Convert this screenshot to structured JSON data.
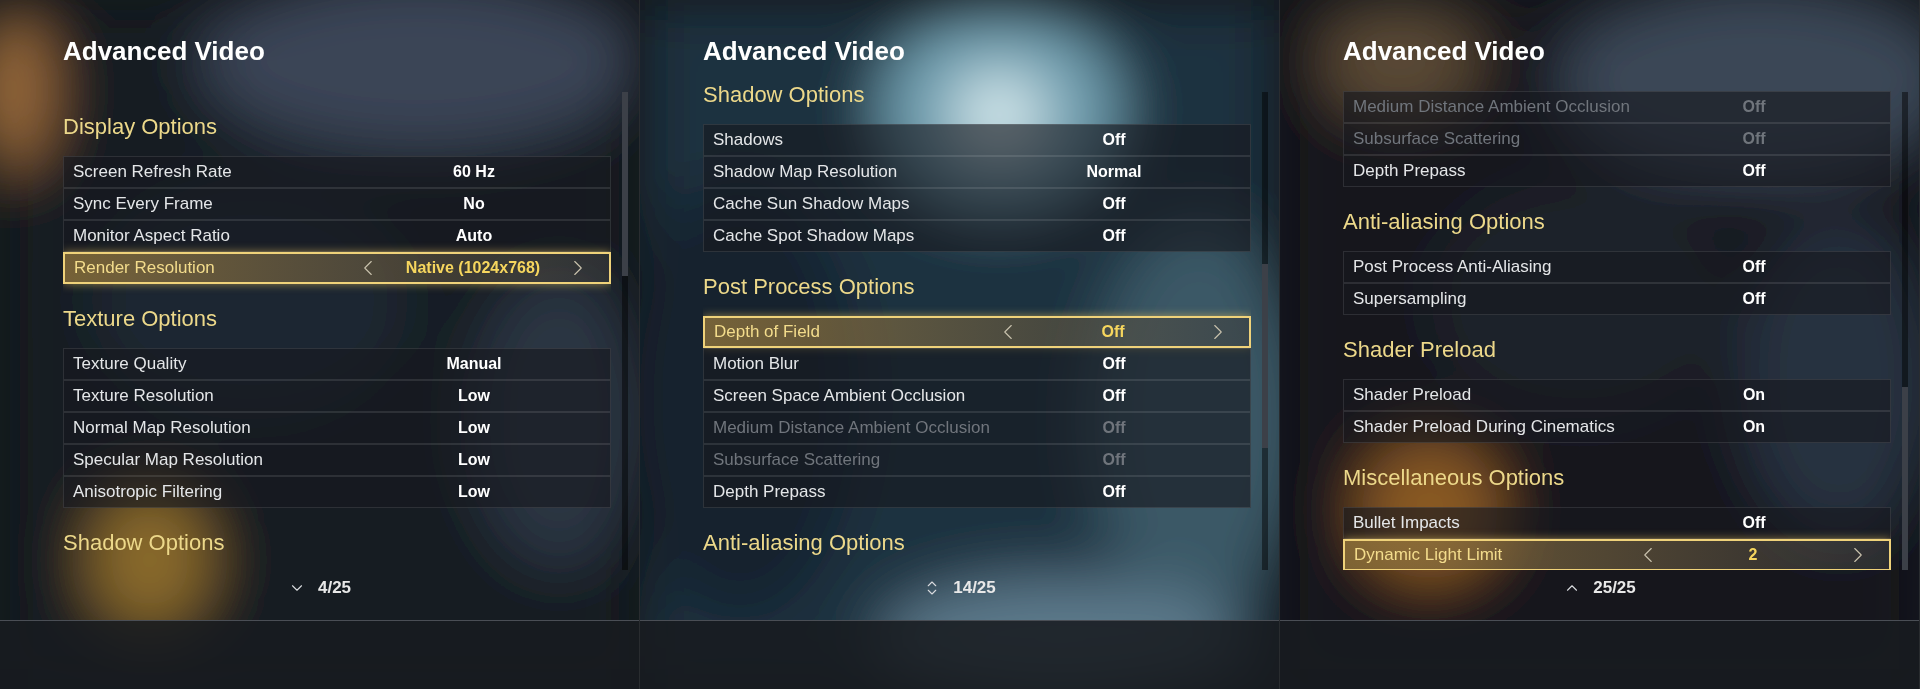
{
  "panels": [
    {
      "title": "Advanced Video",
      "can_scroll_up": false,
      "can_scroll_down": true,
      "counter": "4/25",
      "sections": [
        {
          "header": "Display Options",
          "rows": [
            {
              "label": "Screen Refresh Rate",
              "value": "60 Hz",
              "selected": false,
              "disabled": false
            },
            {
              "label": "Sync Every Frame",
              "value": "No",
              "selected": false,
              "disabled": false
            },
            {
              "label": "Monitor Aspect Ratio",
              "value": "Auto",
              "selected": false,
              "disabled": false
            },
            {
              "label": "Render Resolution",
              "value": "Native (1024x768)",
              "selected": true,
              "disabled": false
            }
          ]
        },
        {
          "header": "Texture Options",
          "rows": [
            {
              "label": "Texture Quality",
              "value": "Manual",
              "selected": false,
              "disabled": false
            },
            {
              "label": "Texture Resolution",
              "value": "Low",
              "selected": false,
              "disabled": false
            },
            {
              "label": "Normal Map Resolution",
              "value": "Low",
              "selected": false,
              "disabled": false
            },
            {
              "label": "Specular Map Resolution",
              "value": "Low",
              "selected": false,
              "disabled": false
            },
            {
              "label": "Anisotropic Filtering",
              "value": "Low",
              "selected": false,
              "disabled": false
            }
          ]
        },
        {
          "header": "Shadow Options"
        }
      ]
    },
    {
      "title": "Advanced Video",
      "can_scroll_up": true,
      "can_scroll_down": true,
      "counter": "14/25",
      "sections": [
        {
          "header": "Shadow Options",
          "rows": [
            {
              "label": "Shadows",
              "value": "Off",
              "selected": false,
              "disabled": false
            },
            {
              "label": "Shadow Map Resolution",
              "value": "Normal",
              "selected": false,
              "disabled": false
            },
            {
              "label": "Cache Sun Shadow Maps",
              "value": "Off",
              "selected": false,
              "disabled": false
            },
            {
              "label": "Cache Spot Shadow Maps",
              "value": "Off",
              "selected": false,
              "disabled": false
            }
          ]
        },
        {
          "header": "Post Process Options",
          "rows": [
            {
              "label": "Depth of Field",
              "value": "Off",
              "selected": true,
              "disabled": false
            },
            {
              "label": "Motion Blur",
              "value": "Off",
              "selected": false,
              "disabled": false
            },
            {
              "label": "Screen Space Ambient Occlusion",
              "value": "Off",
              "selected": false,
              "disabled": false
            },
            {
              "label": "Medium Distance Ambient Occlusion",
              "value": "Off",
              "selected": false,
              "disabled": true
            },
            {
              "label": "Subsurface Scattering",
              "value": "Off",
              "selected": false,
              "disabled": true
            },
            {
              "label": "Depth Prepass",
              "value": "Off",
              "selected": false,
              "disabled": false
            }
          ]
        },
        {
          "header": "Anti-aliasing Options"
        }
      ]
    },
    {
      "title": "Advanced Video",
      "can_scroll_up": true,
      "can_scroll_down": false,
      "counter": "25/25",
      "sections": [
        {
          "rows": [
            {
              "label": "Medium Distance Ambient Occlusion",
              "value": "Off",
              "selected": false,
              "disabled": true
            },
            {
              "label": "Subsurface Scattering",
              "value": "Off",
              "selected": false,
              "disabled": true
            },
            {
              "label": "Depth Prepass",
              "value": "Off",
              "selected": false,
              "disabled": false
            }
          ]
        },
        {
          "header": "Anti-aliasing Options",
          "rows": [
            {
              "label": "Post Process Anti-Aliasing",
              "value": "Off",
              "selected": false,
              "disabled": false
            },
            {
              "label": "Supersampling",
              "value": "Off",
              "selected": false,
              "disabled": false
            }
          ]
        },
        {
          "header": "Shader Preload",
          "rows": [
            {
              "label": "Shader Preload",
              "value": "On",
              "selected": false,
              "disabled": false
            },
            {
              "label": "Shader Preload During Cinematics",
              "value": "On",
              "selected": false,
              "disabled": false
            }
          ]
        },
        {
          "header": "Miscellaneous Options",
          "rows": [
            {
              "label": "Bullet Impacts",
              "value": "Off",
              "selected": false,
              "disabled": false
            },
            {
              "label": "Dynamic Light Limit",
              "value": "2",
              "selected": true,
              "disabled": false
            }
          ]
        }
      ]
    }
  ]
}
